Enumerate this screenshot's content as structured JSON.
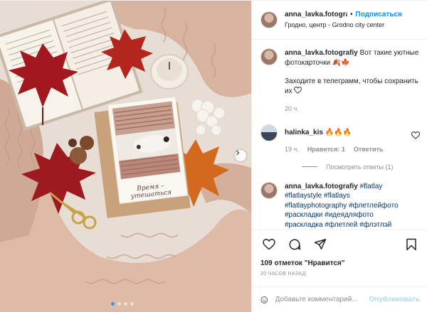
{
  "header": {
    "username": "anna_lavka.fotografiy",
    "separator": "•",
    "follow_label": "Подписаться",
    "location": "Гродно, центр - Grodno city center"
  },
  "photo": {
    "card_caption": "Время – утешаться",
    "carousel_dots": 4,
    "active_dot": 0,
    "next_icon": "chevron-right-icon"
  },
  "caption": {
    "username": "anna_lavka.fotografiy",
    "line1": "Вот такие уютные фотокарточки 🍂🍁",
    "line2": "Заходите в телеграмм, чтобы сохранить их",
    "time": "20 ч."
  },
  "comments": [
    {
      "username": "halinka_kis",
      "text": "🔥🔥🔥",
      "time": "19 ч.",
      "likes_label": "Нравится: 1",
      "reply_label": "Ответить",
      "view_replies": "Посмотреть ответы (1)"
    },
    {
      "username": "anna_lavka.fotografiy",
      "tags": "#flatlay #flatlaystyle #flatlays #flatlayphotography #флетлейфото #раскладки #идеядляфото #раскладка #флетлей #флэтлэй"
    }
  ],
  "actions": {
    "like_icon": "heart-icon",
    "comment_icon": "comment-icon",
    "share_icon": "send-icon",
    "save_icon": "bookmark-icon"
  },
  "likes_text": "109 отметок \"Нравится\"",
  "posted_ago": "20 ЧАСОВ НАЗАД",
  "add_comment": {
    "placeholder": "Добавьте комментарий...",
    "publish_label": "Опубликовать",
    "emoji_icon": "smile-icon"
  },
  "colors": {
    "link_blue": "#0095f6",
    "hashtag": "#00376b",
    "muted": "#8e8e8e",
    "sweater": "#d9b7a3",
    "leaf_red": "#a3171f",
    "leaf_orange": "#d2691e"
  }
}
